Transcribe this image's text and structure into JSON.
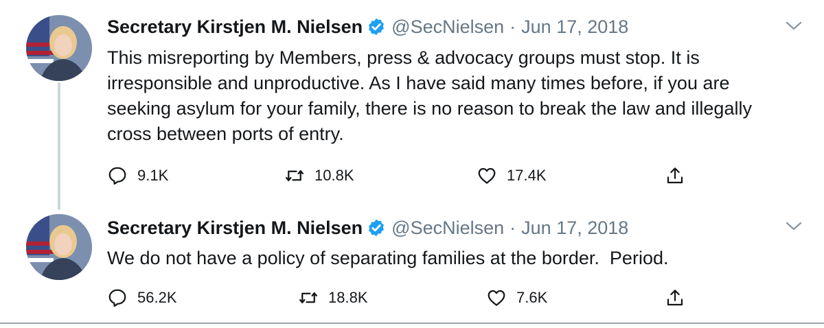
{
  "tweets": [
    {
      "name": "Secretary Kirstjen M. Nielsen",
      "handle": "@SecNielsen",
      "separator": "·",
      "date": "Jun 17, 2018",
      "text": "This misreporting by Members, press & advocacy groups must stop. It is irresponsible and unproductive. As I have said many times before, if you are seeking asylum for your family, there is no reason to break the law and illegally cross between ports of entry.",
      "replies": "9.1K",
      "retweets": "10.8K",
      "likes": "17.4K"
    },
    {
      "name": "Secretary Kirstjen M. Nielsen",
      "handle": "@SecNielsen",
      "separator": "·",
      "date": "Jun 17, 2018",
      "text": "We do not have a policy of separating families at the border.  Period.",
      "replies": "56.2K",
      "retweets": "18.8K",
      "likes": "7.6K"
    }
  ],
  "colors": {
    "verified": "#1da1f2",
    "secondary_text": "#657786",
    "thread_line": "#ccd6dd"
  },
  "icons": [
    "verified-badge-icon",
    "chevron-down-icon",
    "reply-icon",
    "retweet-icon",
    "like-icon",
    "share-icon"
  ]
}
